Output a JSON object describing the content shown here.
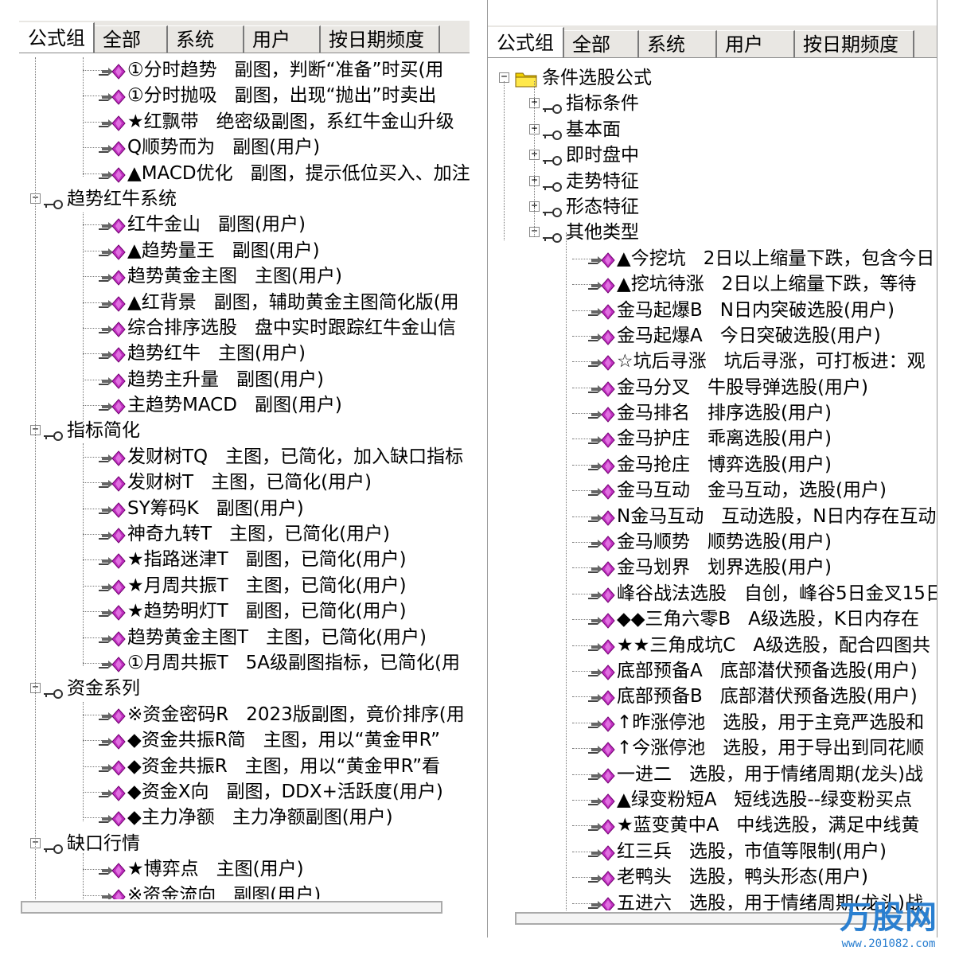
{
  "left_panel": {
    "tabs": [
      "公式组",
      "全部",
      "系统",
      "用户",
      "按日期频度"
    ],
    "rows": [
      {
        "kind": "leaf",
        "depth": 1,
        "text": "①分时趋势",
        "desc": "副图，判断“准备”时买(用"
      },
      {
        "kind": "leaf",
        "depth": 1,
        "text": "①分时抛吸",
        "desc": "副图，出现“抛出”时卖出"
      },
      {
        "kind": "leaf",
        "depth": 1,
        "text": "★红飘带",
        "desc": "绝密级副图，系红牛金山升级"
      },
      {
        "kind": "leaf",
        "depth": 1,
        "text": "Q顺势而为",
        "desc": "副图(用户)"
      },
      {
        "kind": "leaf",
        "depth": 1,
        "text": "▲MACD优化",
        "desc": "副图，提示低位买入、加注"
      },
      {
        "kind": "group",
        "depth": 0,
        "text": "趋势红牛系统",
        "expanded": true
      },
      {
        "kind": "leaf",
        "depth": 1,
        "text": "红牛金山",
        "desc": "副图(用户)"
      },
      {
        "kind": "leaf",
        "depth": 1,
        "text": "▲趋势量王",
        "desc": "副图(用户)"
      },
      {
        "kind": "leaf",
        "depth": 1,
        "text": "趋势黄金主图",
        "desc": "主图(用户)"
      },
      {
        "kind": "leaf",
        "depth": 1,
        "text": "▲红背景",
        "desc": "副图，辅助黄金主图简化版(用"
      },
      {
        "kind": "leaf",
        "depth": 1,
        "text": "综合排序选股",
        "desc": "盘中实时跟踪红牛金山信"
      },
      {
        "kind": "leaf",
        "depth": 1,
        "text": "趋势红牛",
        "desc": "主图(用户)"
      },
      {
        "kind": "leaf",
        "depth": 1,
        "text": "趋势主升量",
        "desc": "副图(用户)"
      },
      {
        "kind": "leaf",
        "depth": 1,
        "text": "主趋势MACD",
        "desc": "副图(用户)"
      },
      {
        "kind": "group",
        "depth": 0,
        "text": "指标简化",
        "expanded": true
      },
      {
        "kind": "leaf",
        "depth": 1,
        "text": "发财树TQ",
        "desc": "主图，已简化，加入缺口指标"
      },
      {
        "kind": "leaf",
        "depth": 1,
        "text": "发财树T",
        "desc": "主图，已简化(用户)"
      },
      {
        "kind": "leaf",
        "depth": 1,
        "text": "SY筹码K",
        "desc": "副图(用户)"
      },
      {
        "kind": "leaf",
        "depth": 1,
        "text": "神奇九转T",
        "desc": "主图，已简化(用户)"
      },
      {
        "kind": "leaf",
        "depth": 1,
        "text": "★指路迷津T",
        "desc": "副图，已简化(用户)"
      },
      {
        "kind": "leaf",
        "depth": 1,
        "text": "★月周共振T",
        "desc": "主图，已简化(用户)"
      },
      {
        "kind": "leaf",
        "depth": 1,
        "text": "★趋势明灯T",
        "desc": "副图，已简化(用户)"
      },
      {
        "kind": "leaf",
        "depth": 1,
        "text": "趋势黄金主图T",
        "desc": "主图，已简化(用户)"
      },
      {
        "kind": "leaf",
        "depth": 1,
        "text": "①月周共振T",
        "desc": "5A级副图指标，已简化(用"
      },
      {
        "kind": "group",
        "depth": 0,
        "text": "资金系列",
        "expanded": true
      },
      {
        "kind": "leaf",
        "depth": 1,
        "text": "※资金密码R",
        "desc": "2023版副图，竟价排序(用"
      },
      {
        "kind": "leaf",
        "depth": 1,
        "text": "◆资金共振R简",
        "desc": "主图，用以“黄金甲R”"
      },
      {
        "kind": "leaf",
        "depth": 1,
        "text": "◆资金共振R",
        "desc": "主图，用以“黄金甲R”看"
      },
      {
        "kind": "leaf",
        "depth": 1,
        "text": "◆资金X向",
        "desc": "副图，DDX+活跃度(用户)"
      },
      {
        "kind": "leaf",
        "depth": 1,
        "text": "◆主力净额",
        "desc": "主力净额副图(用户)"
      },
      {
        "kind": "group",
        "depth": 0,
        "text": "缺口行情",
        "expanded": true
      },
      {
        "kind": "leaf",
        "depth": 1,
        "text": "★博弈点",
        "desc": "主图(用户)"
      },
      {
        "kind": "leaf",
        "depth": 1,
        "text": "※资金流向",
        "desc": "副图(用户)"
      }
    ]
  },
  "right_panel": {
    "tabs": [
      "公式组",
      "全部",
      "系统",
      "用户",
      "按日期频度"
    ],
    "rows": [
      {
        "kind": "root",
        "depth": 0,
        "text": "条件选股公式",
        "expanded": true
      },
      {
        "kind": "group",
        "depth": 1,
        "text": "指标条件",
        "expanded": false
      },
      {
        "kind": "group",
        "depth": 1,
        "text": "基本面",
        "expanded": false
      },
      {
        "kind": "group",
        "depth": 1,
        "text": "即时盘中",
        "expanded": false
      },
      {
        "kind": "group",
        "depth": 1,
        "text": "走势特征",
        "expanded": false
      },
      {
        "kind": "group",
        "depth": 1,
        "text": "形态特征",
        "expanded": false
      },
      {
        "kind": "group",
        "depth": 1,
        "text": "其他类型",
        "expanded": true
      },
      {
        "kind": "leaf",
        "depth": 2,
        "text": "▲今挖坑",
        "desc": "2日以上缩量下跌，包含今日"
      },
      {
        "kind": "leaf",
        "depth": 2,
        "text": "▲挖坑待涨",
        "desc": "2日以上缩量下跌，等待"
      },
      {
        "kind": "leaf",
        "depth": 2,
        "text": "金马起爆B",
        "desc": "N日内突破选股(用户)"
      },
      {
        "kind": "leaf",
        "depth": 2,
        "text": "金马起爆A",
        "desc": "今日突破选股(用户)"
      },
      {
        "kind": "leaf",
        "depth": 2,
        "text": "☆坑后寻涨",
        "desc": "坑后寻涨，可打板进：观"
      },
      {
        "kind": "leaf",
        "depth": 2,
        "text": "金马分叉",
        "desc": "牛股导弹选股(用户)"
      },
      {
        "kind": "leaf",
        "depth": 2,
        "text": "金马排名",
        "desc": "排序选股(用户)"
      },
      {
        "kind": "leaf",
        "depth": 2,
        "text": "金马护庄",
        "desc": "乖离选股(用户)"
      },
      {
        "kind": "leaf",
        "depth": 2,
        "text": "金马抢庄",
        "desc": "博弈选股(用户)"
      },
      {
        "kind": "leaf",
        "depth": 2,
        "text": "金马互动",
        "desc": "金马互动，选股(用户)"
      },
      {
        "kind": "leaf",
        "depth": 2,
        "text": "N金马互动",
        "desc": "互动选股，N日内存在互动"
      },
      {
        "kind": "leaf",
        "depth": 2,
        "text": "金马顺势",
        "desc": "顺势选股(用户)"
      },
      {
        "kind": "leaf",
        "depth": 2,
        "text": "金马划界",
        "desc": "划界选股(用户)"
      },
      {
        "kind": "leaf",
        "depth": 2,
        "text": "峰谷战法选股",
        "desc": "自创，峰谷5日金叉15日"
      },
      {
        "kind": "leaf",
        "depth": 2,
        "text": "◆◆三角六零B",
        "desc": "A级选股，K日内存在"
      },
      {
        "kind": "leaf",
        "depth": 2,
        "text": "★★三角成坑C",
        "desc": "A级选股，配合四图共"
      },
      {
        "kind": "leaf",
        "depth": 2,
        "text": "底部预备A",
        "desc": "底部潜伏预备选股(用户)"
      },
      {
        "kind": "leaf",
        "depth": 2,
        "text": "底部预备B",
        "desc": "底部潜伏预备选股(用户)"
      },
      {
        "kind": "leaf",
        "depth": 2,
        "text": "↑昨涨停池",
        "desc": "选股，用于主竞严选股和"
      },
      {
        "kind": "leaf",
        "depth": 2,
        "text": "↑今涨停池",
        "desc": "选股，用于导出到同花顺"
      },
      {
        "kind": "leaf",
        "depth": 2,
        "text": "一进二",
        "desc": "选股，用于情绪周期(龙头)战"
      },
      {
        "kind": "leaf",
        "depth": 2,
        "text": "▲绿变粉短A",
        "desc": "短线选股--绿变粉买点"
      },
      {
        "kind": "leaf",
        "depth": 2,
        "text": "★蓝变黄中A",
        "desc": "中线选股，满足中线黄"
      },
      {
        "kind": "leaf",
        "depth": 2,
        "text": "红三兵",
        "desc": "选股，市值等限制(用户)"
      },
      {
        "kind": "leaf",
        "depth": 2,
        "text": "老鸭头",
        "desc": "选股，鸭头形态(用户)"
      },
      {
        "kind": "leaf",
        "depth": 2,
        "text": "五进六",
        "desc": "选股，用于情绪周期(龙头)战"
      }
    ]
  },
  "watermark": {
    "logo": "万股网",
    "url": "www.201082.com"
  },
  "colors": {
    "tab_bg": "#e9e7e3",
    "leaf_icon": "#c030c0",
    "folder": "#f0d000",
    "selection": "#ffffff"
  }
}
